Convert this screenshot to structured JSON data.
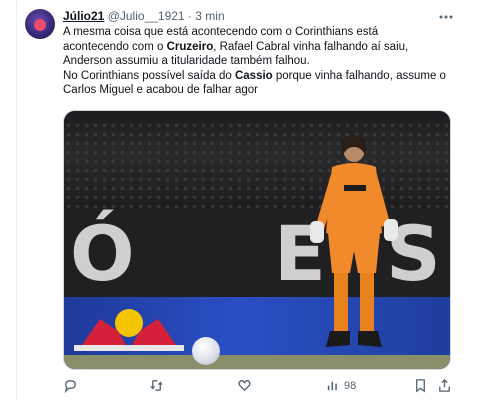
{
  "author": {
    "display_name": "Júlio21",
    "handle": "@Julio__1921",
    "time": "3 min"
  },
  "tweet": {
    "line1": "A mesma coisa que está acontecendo com o Corinthians está",
    "line2_a": "acontecendo com o ",
    "line2_b": "Cruzeiro",
    "line2_c": ", Rafael Cabral vinha falhando aí saiu,",
    "line3": "Anderson assumiu a titularidade também falhou.",
    "line4_a": "No Corinthians possível saída do ",
    "line4_b": "Cassio",
    "line4_c": " porque vinha falhando, assume o",
    "line5": "Carlos Miguel e acabou de falhar agor"
  },
  "media": {
    "banner_letters": [
      "Ó",
      "E",
      "S"
    ]
  },
  "actions": {
    "views": "98"
  },
  "colors": {
    "text": "#0f1419",
    "meta": "#536471",
    "jersey": "#f08a2a"
  },
  "icons": [
    "more-icon",
    "reply-icon",
    "retweet-icon",
    "like-icon",
    "views-icon",
    "bookmark-icon",
    "share-icon"
  ]
}
